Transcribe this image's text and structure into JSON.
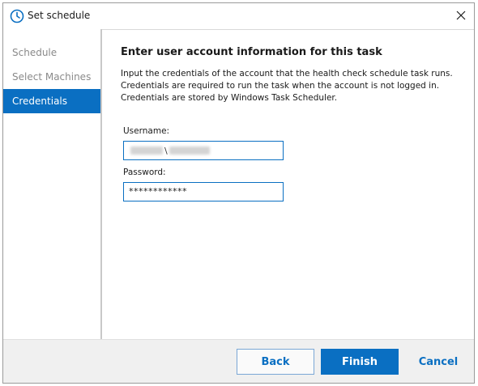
{
  "window": {
    "title": "Set schedule",
    "title_icon": "clock-icon",
    "close_icon": "close-icon"
  },
  "sidebar": {
    "items": [
      {
        "label": "Schedule",
        "active": false
      },
      {
        "label": "Select Machines",
        "active": false
      },
      {
        "label": "Credentials",
        "active": true
      }
    ]
  },
  "main": {
    "heading": "Enter user account information for this task",
    "description": [
      "Input the credentials of the account that the health check schedule task runs.",
      "Credentials are required to run the task when the account is not logged in.",
      "Credentials are stored by Windows Task Scheduler."
    ],
    "username": {
      "label": "Username:",
      "separator": "\\"
    },
    "password": {
      "label": "Password:",
      "value": "************"
    }
  },
  "footer": {
    "back_label": "Back",
    "finish_label": "Finish",
    "cancel_label": "Cancel"
  },
  "colors": {
    "accent": "#0a6fc2",
    "footer_bg": "#f0f0f0"
  }
}
